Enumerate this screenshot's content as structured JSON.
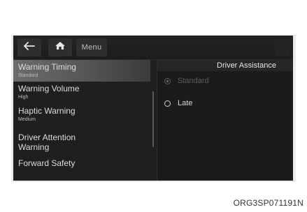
{
  "toolbar": {
    "back_icon": "back-arrow-icon",
    "home_icon": "home-icon",
    "menu_label": "Menu"
  },
  "sidebar": {
    "items": [
      {
        "label": "Warning Timing",
        "sub": "Standard"
      },
      {
        "label": "Warning Volume",
        "sub": "High"
      },
      {
        "label": "Haptic Warning",
        "sub": "Medium"
      },
      {
        "label": "Driver Attention Warning",
        "sub": ""
      },
      {
        "label": "Forward Safety",
        "sub": ""
      }
    ]
  },
  "content": {
    "title": "Driver Assistance",
    "options": [
      {
        "label": "Standard",
        "state": "selected-disabled"
      },
      {
        "label": "Late",
        "state": "unselected"
      }
    ]
  },
  "caption": "ORG3SP071191N",
  "colors": {
    "screen_bg": "#1b1b1b",
    "selected_item": "#6c6c6c",
    "text": "#dcdcdc",
    "disabled_text": "#5e5e5e"
  }
}
